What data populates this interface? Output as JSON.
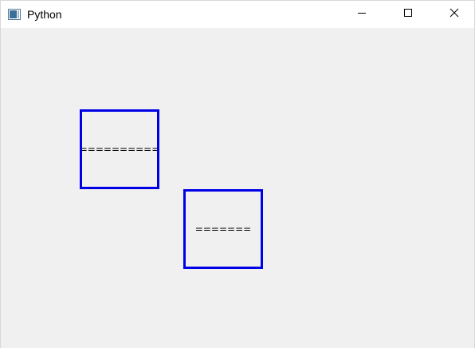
{
  "window": {
    "title": "Python",
    "app_icon": "python-window-icon",
    "controls": {
      "minimize_icon": "minimize-icon",
      "maximize_icon": "maximize-icon",
      "close_icon": "close-icon"
    }
  },
  "canvas": {
    "background": "#f0f0f0",
    "boxes": [
      {
        "text": "==========",
        "border_color": "#0000e6"
      },
      {
        "text": "=======",
        "border_color": "#0000e6"
      }
    ]
  }
}
